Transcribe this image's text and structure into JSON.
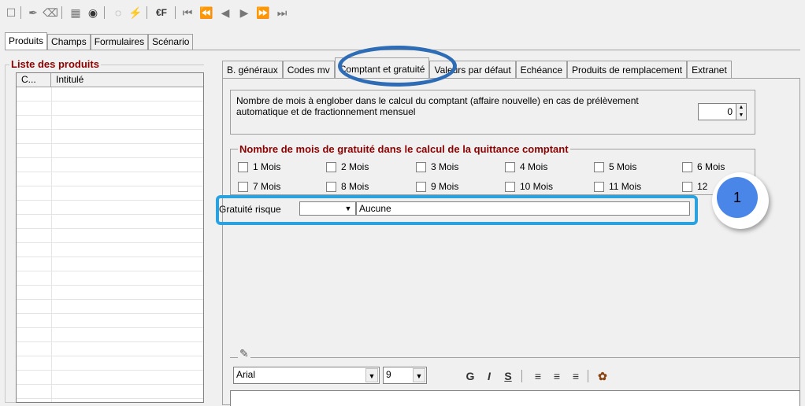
{
  "toolbar": {
    "icons": [
      "new-icon",
      "edit-icon",
      "eraser-icon",
      "list-icon",
      "camera-icon",
      "binoculars-icon",
      "lightning-icon",
      "euro-icon",
      "first-icon",
      "fast-back-icon",
      "prev-icon",
      "next-icon",
      "fast-forward-icon",
      "last-icon"
    ],
    "euro_label": "€F"
  },
  "tabs": [
    "Produits",
    "Champs",
    "Formulaires",
    "Scénario"
  ],
  "left": {
    "title": "Liste des produits",
    "columns": [
      "C...",
      "Intitulé"
    ]
  },
  "subtabs": [
    "B. généraux",
    "Codes mv",
    "Comptant et gratuité",
    "Valeurs par défaut",
    "Echéance",
    "Produits de remplacement",
    "Extranet"
  ],
  "months_box": {
    "text": "Nombre de mois à englober dans le calcul du comptant (affaire nouvelle) en cas de prélèvement automatique et de fractionnement mensuel",
    "value": "0"
  },
  "gratuite": {
    "title": "Nombre de mois de gratuité dans le calcul de la quittance comptant",
    "months": [
      "1 Mois",
      "2 Mois",
      "3 Mois",
      "4 Mois",
      "5 Mois",
      "6 Mois",
      "7 Mois",
      "8 Mois",
      "9 Mois",
      "10 Mois",
      "11 Mois",
      "12"
    ]
  },
  "risque": {
    "label": "Gratuité risque",
    "value": "Aucune"
  },
  "annotation": {
    "badge": "1"
  },
  "editor": {
    "font": "Arial",
    "size": "9",
    "bold": "G",
    "italic": "I",
    "underline": "S"
  },
  "colors": {
    "highlight": "#2ba2e0",
    "circle": "#2e6db5",
    "badge": "#4a86e8",
    "title": "#8b0000"
  }
}
